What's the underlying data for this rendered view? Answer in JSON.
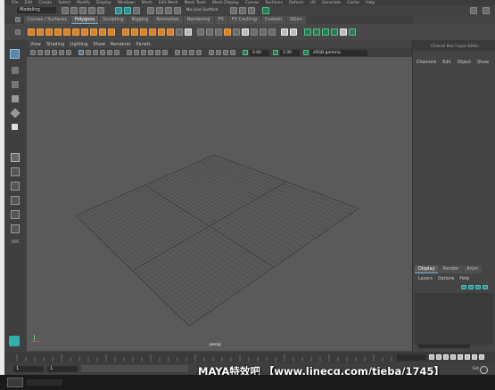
{
  "main_menu": {
    "items": [
      "File",
      "Edit",
      "Create",
      "Select",
      "Modify",
      "Display",
      "Windows",
      "Mesh",
      "Edit Mesh",
      "Mesh Tools",
      "Mesh Display",
      "Curves",
      "Surfaces",
      "Deform",
      "UV",
      "Generate",
      "Cache",
      "Help"
    ]
  },
  "status_line": {
    "mode": "Modeling",
    "live_surface": "No Live Surface"
  },
  "shelf": {
    "tabs": [
      "Curves / Surfaces",
      "Polygons",
      "Sculpting",
      "Rigging",
      "Animation",
      "Rendering",
      "FX",
      "FX Caching",
      "Custom",
      "XGen"
    ],
    "active_tab": "Polygons"
  },
  "viewport": {
    "menu": [
      "View",
      "Shading",
      "Lighting",
      "Show",
      "Renderer",
      "Panels"
    ],
    "exposure": "0.00",
    "gamma": "1.00",
    "color_space": "sRGB gamma",
    "camera_label": "persp"
  },
  "channel_box": {
    "title_tabs": [
      "Channel Box / Layer Editor"
    ],
    "menu": [
      "Channels",
      "Edit",
      "Object",
      "Show"
    ]
  },
  "layer_editor": {
    "tabs": [
      "Display",
      "Render",
      "Anim"
    ],
    "menu": [
      "Layers",
      "Options",
      "Help"
    ]
  },
  "time_slider": {
    "start_frame": "1",
    "range_start": "1"
  },
  "right_hint": "Set",
  "watermark": "MAYA特效吧 【www.linecg.com/tieba/1745】",
  "colors": {
    "ui_bg": "#444444",
    "viewport_bg": "#5a5a5a",
    "grid": "#4a4a4a",
    "accent_blue": "#6fb3e0",
    "shelf_icon_orange": "#d9822b",
    "taskbar_dark": "#1a1a1a"
  }
}
